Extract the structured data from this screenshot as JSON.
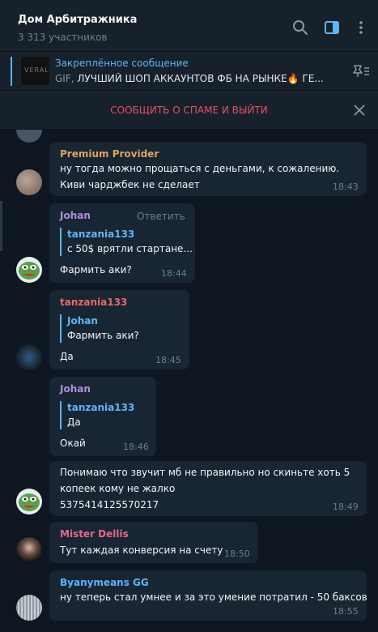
{
  "header": {
    "title": "Дом Арбитражника",
    "subtitle": "3 313 участников"
  },
  "pinned": {
    "title": "Закреплённое сообщение",
    "prefix": "GIF,",
    "text": "ЛУЧШИЙ ШОП АККАУНТОВ ФБ НА РЫНКЕ🔥    ГЕ...",
    "thumb_text": "VERAL"
  },
  "spam_bar": {
    "label": "СООБЩИТЬ О СПАМЕ И ВЫЙТИ"
  },
  "messages": [
    {
      "sender": "Premium Provider",
      "lines": [
        "ну тогда можно прощаться с деньгами, к сожалению.",
        "Киви чарджбек не сделает"
      ],
      "time": "18:43"
    },
    {
      "sender": "Johan",
      "reply_action": "Ответить",
      "reply": {
        "name": "tanzania133",
        "text": "с 50$ врятли стартане..."
      },
      "lines": [
        "Фармить аки?"
      ],
      "time": "18:44"
    },
    {
      "sender": "tanzania133",
      "reply": {
        "name": "Johan",
        "text": "Фармить аки?"
      },
      "lines": [
        "Да"
      ],
      "time": "18:45"
    },
    {
      "sender": "Johan",
      "reply": {
        "name": "tanzania133",
        "text": "Да"
      },
      "lines": [
        "Окай"
      ],
      "time": "18:46"
    },
    {
      "sender": "",
      "lines": [
        "Понимаю что звучит мб не правильно но скиньте хоть 5",
        "копеек кому не жалко",
        "5375414125570217"
      ],
      "time": "18:49"
    },
    {
      "sender": "Mister Dellis",
      "lines": [
        "Тут каждая конверсия на счету"
      ],
      "time": "18:50"
    },
    {
      "sender": "Byanymeans GG",
      "lines": [
        "ну теперь стал умнее и за это умение потратил - 50 баксов"
      ],
      "time": "18:55"
    }
  ],
  "colors": {
    "premium_provider": "#e0a35e",
    "johan": "#b28ddd",
    "tanzania133": "#e6696e",
    "mister_dellis": "#e6698a",
    "byanymeans": "#5eb5f7"
  },
  "icons": [
    "search-icon",
    "sidebar-toggle-icon",
    "more-vertical-icon",
    "unpin-icon",
    "close-icon"
  ]
}
